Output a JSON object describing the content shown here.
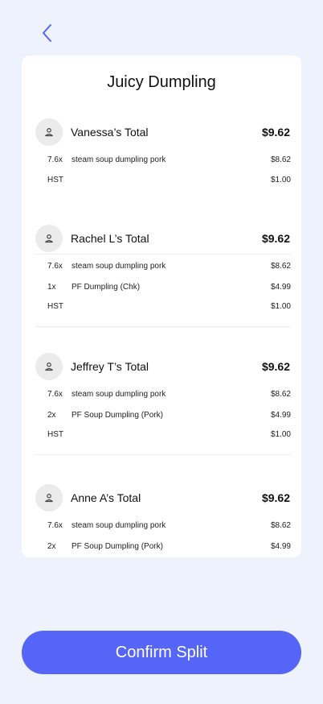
{
  "header": {
    "back_icon": "chevron-left-icon",
    "accent_color": "#5565F7"
  },
  "card": {
    "title": "Juicy Dumpling"
  },
  "people": [
    {
      "name": "Vanessa’s Total",
      "total": "$9.62",
      "avatar_icon": "user-icon",
      "items": [
        {
          "qty": "7.6x",
          "desc": "steam soup dumpling pork",
          "amount": "$8.62"
        },
        {
          "qty": "HST",
          "desc": "",
          "amount": "$1.00"
        }
      ]
    },
    {
      "name": "Rachel L’s Total",
      "total": "$9.62",
      "avatar_icon": "user-icon",
      "items": [
        {
          "qty": "7.6x",
          "desc": "steam soup dumpling pork",
          "amount": "$8.62"
        },
        {
          "qty": "1x",
          "desc": "PF Dumpling (Chk)",
          "amount": "$4.99"
        },
        {
          "qty": "HST",
          "desc": "",
          "amount": "$1.00"
        }
      ]
    },
    {
      "name": "Jeffrey T’s Total",
      "total": "$9.62",
      "avatar_icon": "user-icon",
      "items": [
        {
          "qty": "7.6x",
          "desc": "steam soup dumpling pork",
          "amount": "$8.62"
        },
        {
          "qty": "2x",
          "desc": "PF Soup Dumpling (Pork)",
          "amount": "$4.99"
        },
        {
          "qty": "HST",
          "desc": "",
          "amount": "$1.00"
        }
      ]
    },
    {
      "name": "Anne A’s Total",
      "total": "$9.62",
      "avatar_icon": "user-icon",
      "items": [
        {
          "qty": "7.6x",
          "desc": "steam soup dumpling pork",
          "amount": "$8.62"
        },
        {
          "qty": "2x",
          "desc": "PF Soup Dumpling (Pork)",
          "amount": "$4.99"
        }
      ]
    }
  ],
  "footer": {
    "confirm_label": "Confirm Split"
  }
}
